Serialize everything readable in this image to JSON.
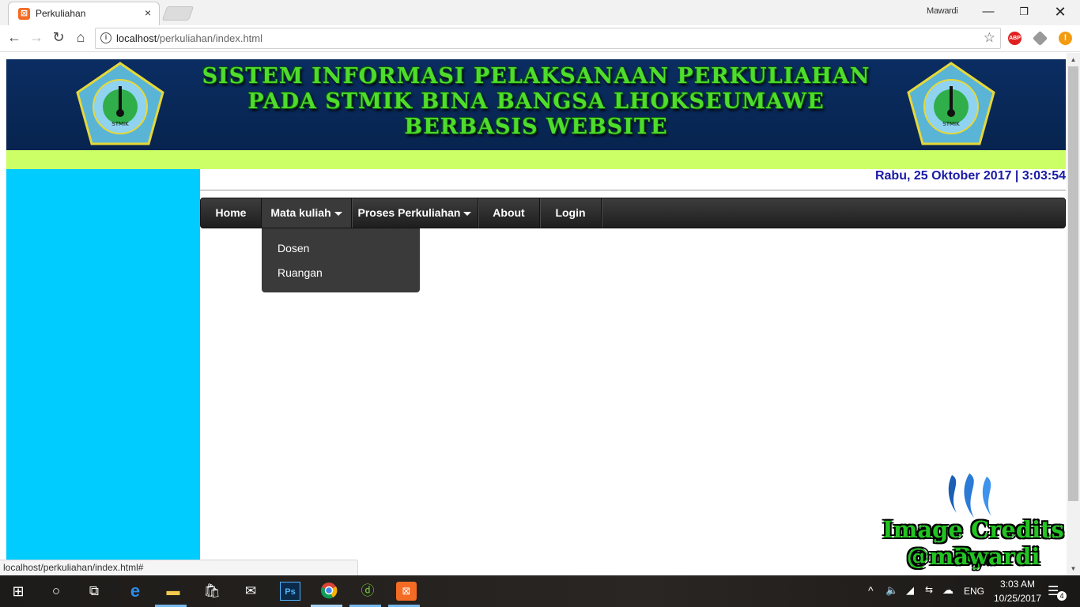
{
  "browser": {
    "tab_title": "Perkuliahan",
    "tab_favicon": "xampp-icon",
    "close_glyph": "×",
    "user_name": "Mawardi",
    "url_host": "localhost",
    "url_path": "/perkuliahan/index.html",
    "status_url": "localhost/perkuliahan/index.html#",
    "extensions": [
      "ABP",
      "",
      "!"
    ]
  },
  "page": {
    "banner_lines": [
      "SISTEM INFORMASI PELAKSANAAN PERKULIAHAN",
      "PADA STMIK BINA BANGSA LHOKSEUMAWE",
      "BERBASIS WEBSITE"
    ],
    "logo_text": "STMIK",
    "clock": "Rabu, 25 Oktober 2017 | 3:03:54",
    "menu": [
      {
        "label": "Home"
      },
      {
        "label": "Mata kuliah"
      },
      {
        "label": "Proses Perkuliahan"
      },
      {
        "label": "About"
      },
      {
        "label": "Login"
      }
    ],
    "dropdown": [
      "Dosen",
      "Ruangan"
    ],
    "credit_line1": "Image Credits By:",
    "credit_line2": "@mawardi",
    "colors": {
      "banner": "#0a2d62",
      "banner_text": "#4fdc2c",
      "green_bar": "#ccff66",
      "sidebar": "#00ccff",
      "clock_text": "#1a1aa6",
      "menubar": "#2b2b2b"
    }
  },
  "taskbar": {
    "language": "ENG",
    "time": "3:03 AM",
    "date": "10/25/2017",
    "notification_count": "4"
  }
}
